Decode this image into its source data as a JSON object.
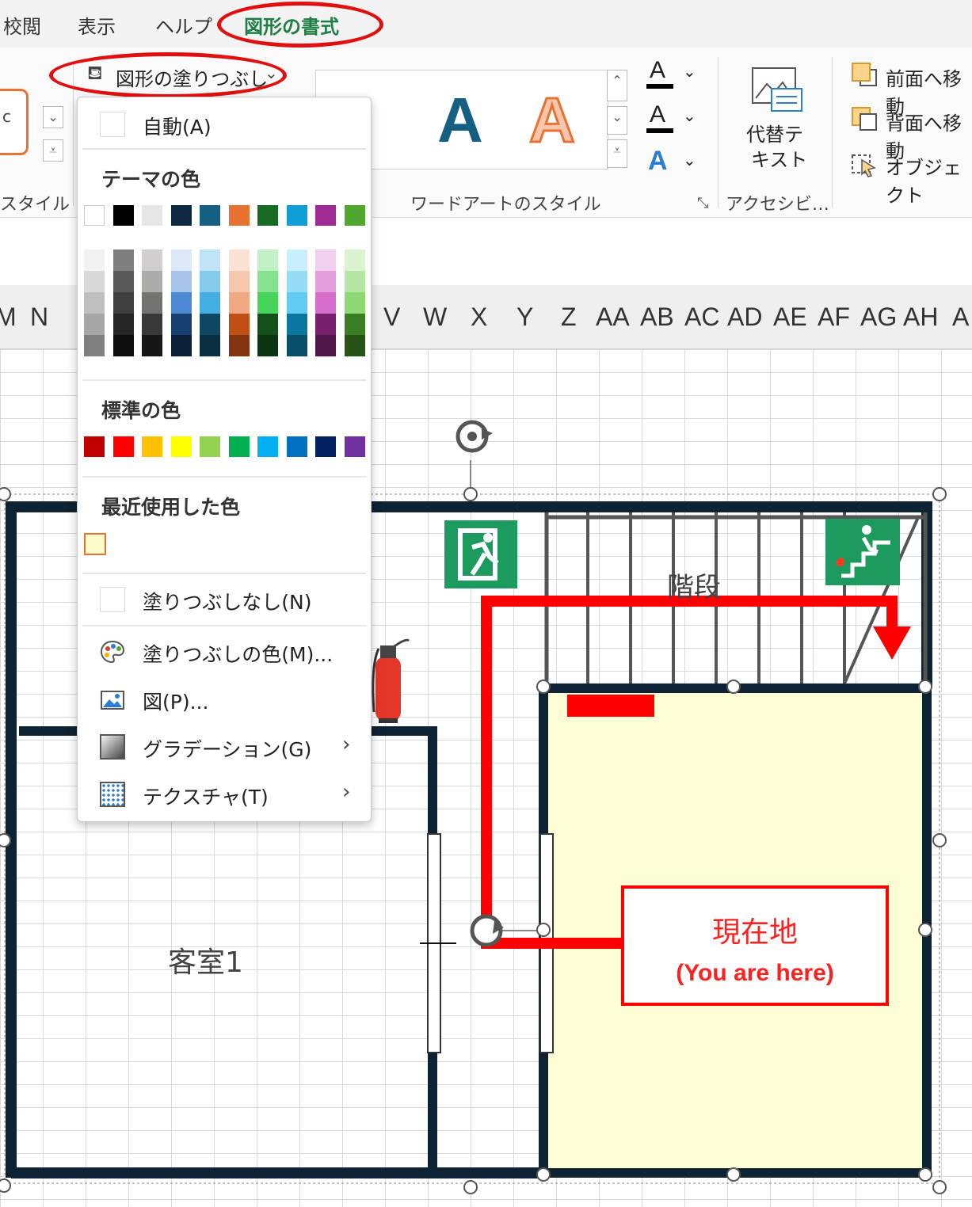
{
  "tabs": [
    "校閲",
    "表示",
    "ヘルプ",
    "図形の書式"
  ],
  "ribbon": {
    "fill_button": "図形の塗りつぶし",
    "wordart_a": "A",
    "text_effect_a": "A",
    "alt_text_line1": "代替テ",
    "alt_text_line2": "キスト",
    "bring_forward": "前面へ移動",
    "send_backward": "背面へ移動",
    "selection_pane": "オブジェクト",
    "group_shape_style": "スタイル",
    "group_wordart": "ワードアートのスタイル",
    "group_access": "アクセシビ…",
    "style_preview": "c"
  },
  "columns": [
    "M",
    "N",
    "V",
    "W",
    "X",
    "Y",
    "Z",
    "AA",
    "AB",
    "AC",
    "AD",
    "AE",
    "AF",
    "AG",
    "AH",
    "A"
  ],
  "menu": {
    "auto": "自動(A)",
    "theme_colors": "テーマの色",
    "standard_colors": "標準の色",
    "recent_colors": "最近使用した色",
    "no_fill": "塗りつぶしなし(N)",
    "more_colors": "塗りつぶしの色(M)...",
    "picture": "図(P)...",
    "gradient": "グラデーション(G)",
    "texture": "テクスチャ(T)"
  },
  "colors": {
    "theme_top": [
      "#ffffff",
      "#000000",
      "#e7e6e6",
      "#0e2841",
      "#156082",
      "#e97132",
      "#196b24",
      "#0f9ed5",
      "#a02b93",
      "#4ea72e"
    ],
    "theme_shades": [
      [
        "#f2f2f2",
        "#d9d9d9",
        "#bfbfbf",
        "#a6a6a6",
        "#808080"
      ],
      [
        "#7f7f7f",
        "#595959",
        "#404040",
        "#262626",
        "#0d0d0d"
      ],
      [
        "#d0cece",
        "#afabab",
        "#767171",
        "#3a3838",
        "#171616"
      ],
      [
        "#dae8f7",
        "#a7c5ea",
        "#4d8ad3",
        "#163f70",
        "#0b2038"
      ],
      [
        "#c0e4f5",
        "#83caeb",
        "#44b0e2",
        "#0f4761",
        "#0a2f41"
      ],
      [
        "#fbe2d5",
        "#f6c6ad",
        "#f1a983",
        "#c04f15",
        "#80350e"
      ],
      [
        "#c1f0c7",
        "#84e291",
        "#47d45a",
        "#124f1a",
        "#0c3511"
      ],
      [
        "#caeefb",
        "#95dcf7",
        "#61cbf3",
        "#0b76a0",
        "#074f6a"
      ],
      [
        "#f2ceef",
        "#e59edd",
        "#d86ecc",
        "#77206d",
        "#501549"
      ],
      [
        "#d9f2d0",
        "#b4e5a2",
        "#8ed973",
        "#3a7d22",
        "#275317"
      ]
    ],
    "standard": [
      "#c00000",
      "#ff0000",
      "#ffc000",
      "#ffff00",
      "#92d050",
      "#00b050",
      "#00b0f0",
      "#0070c0",
      "#002060",
      "#7030a0"
    ],
    "recent": [
      "#fffccc"
    ],
    "accent_red": "#e01010",
    "wall": "#0d2232",
    "room_fill": "#fdfdd6",
    "sign_green": "#1d9b5f"
  },
  "floorplan": {
    "stairs_label": "階段",
    "room_label": "客室1",
    "here_label": "現在地",
    "here_sub": "(You are here)"
  }
}
